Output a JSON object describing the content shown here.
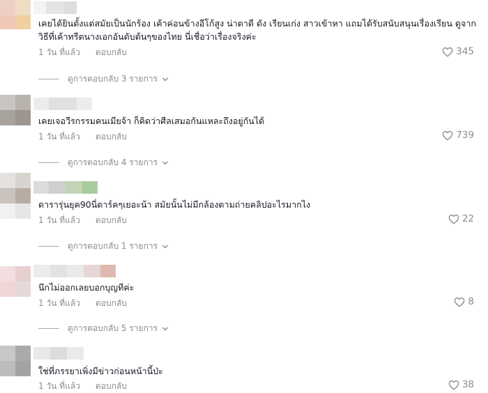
{
  "comments": [
    {
      "text": "เคยได้ยินตั้งแต่สมัยเป็นนักร้อง เค้าค่อนข้างอีโก้สูง น่าตาดี ดัง เรียนเก่ง สาวเข้าหา แถมได้รับสนับสนุนเรื่องเรียน ดูจากวิธีที่เค้าทรีตนางเอกอันดับต้นๆของไทย นี่เชื่อว่าเรื่องจริงค่ะ",
      "time": "1 วัน ที่แล้ว",
      "reply_label": "ตอบกลับ",
      "likes": "345",
      "view_replies": "ดูการตอบกลับ 3 รายการ"
    },
    {
      "text": "เคยเจอวีรกรรมคนเมียจ้า ก็คิดว่าศีลเสมอกันแหละถึงอยู่กันได้",
      "time": "1 วัน ที่แล้ว",
      "reply_label": "ตอบกลับ",
      "likes": "739",
      "view_replies": "ดูการตอบกลับ 4 รายการ"
    },
    {
      "text": "ดารารุ่นยุค90นี่ดาร์คๆเยอะน้า สมัยนั้นไม่มีกล้องตามถ่ายคลิปอะไรมากไง",
      "time": "1 วัน ที่แล้ว",
      "reply_label": "ตอบกลับ",
      "likes": "22",
      "view_replies": "ดูการตอบกลับ 1 รายการ"
    },
    {
      "text": "นึกไม่ออกเลยบอกบุญทีค่ะ",
      "time": "1 วัน ที่แล้ว",
      "reply_label": "ตอบกลับ",
      "likes": "8",
      "view_replies": "ดูการตอบกลับ 5 รายการ"
    },
    {
      "text": "ใช่ที่ภรรยาเพิ่งมีข่าวก่อนหน้านี้ป่ะ",
      "time": "1 วัน ที่แล้ว",
      "reply_label": "ตอบกลับ",
      "likes": "38"
    }
  ],
  "colors": {
    "text_primary": "#161823",
    "text_secondary": "#8a8b91"
  }
}
